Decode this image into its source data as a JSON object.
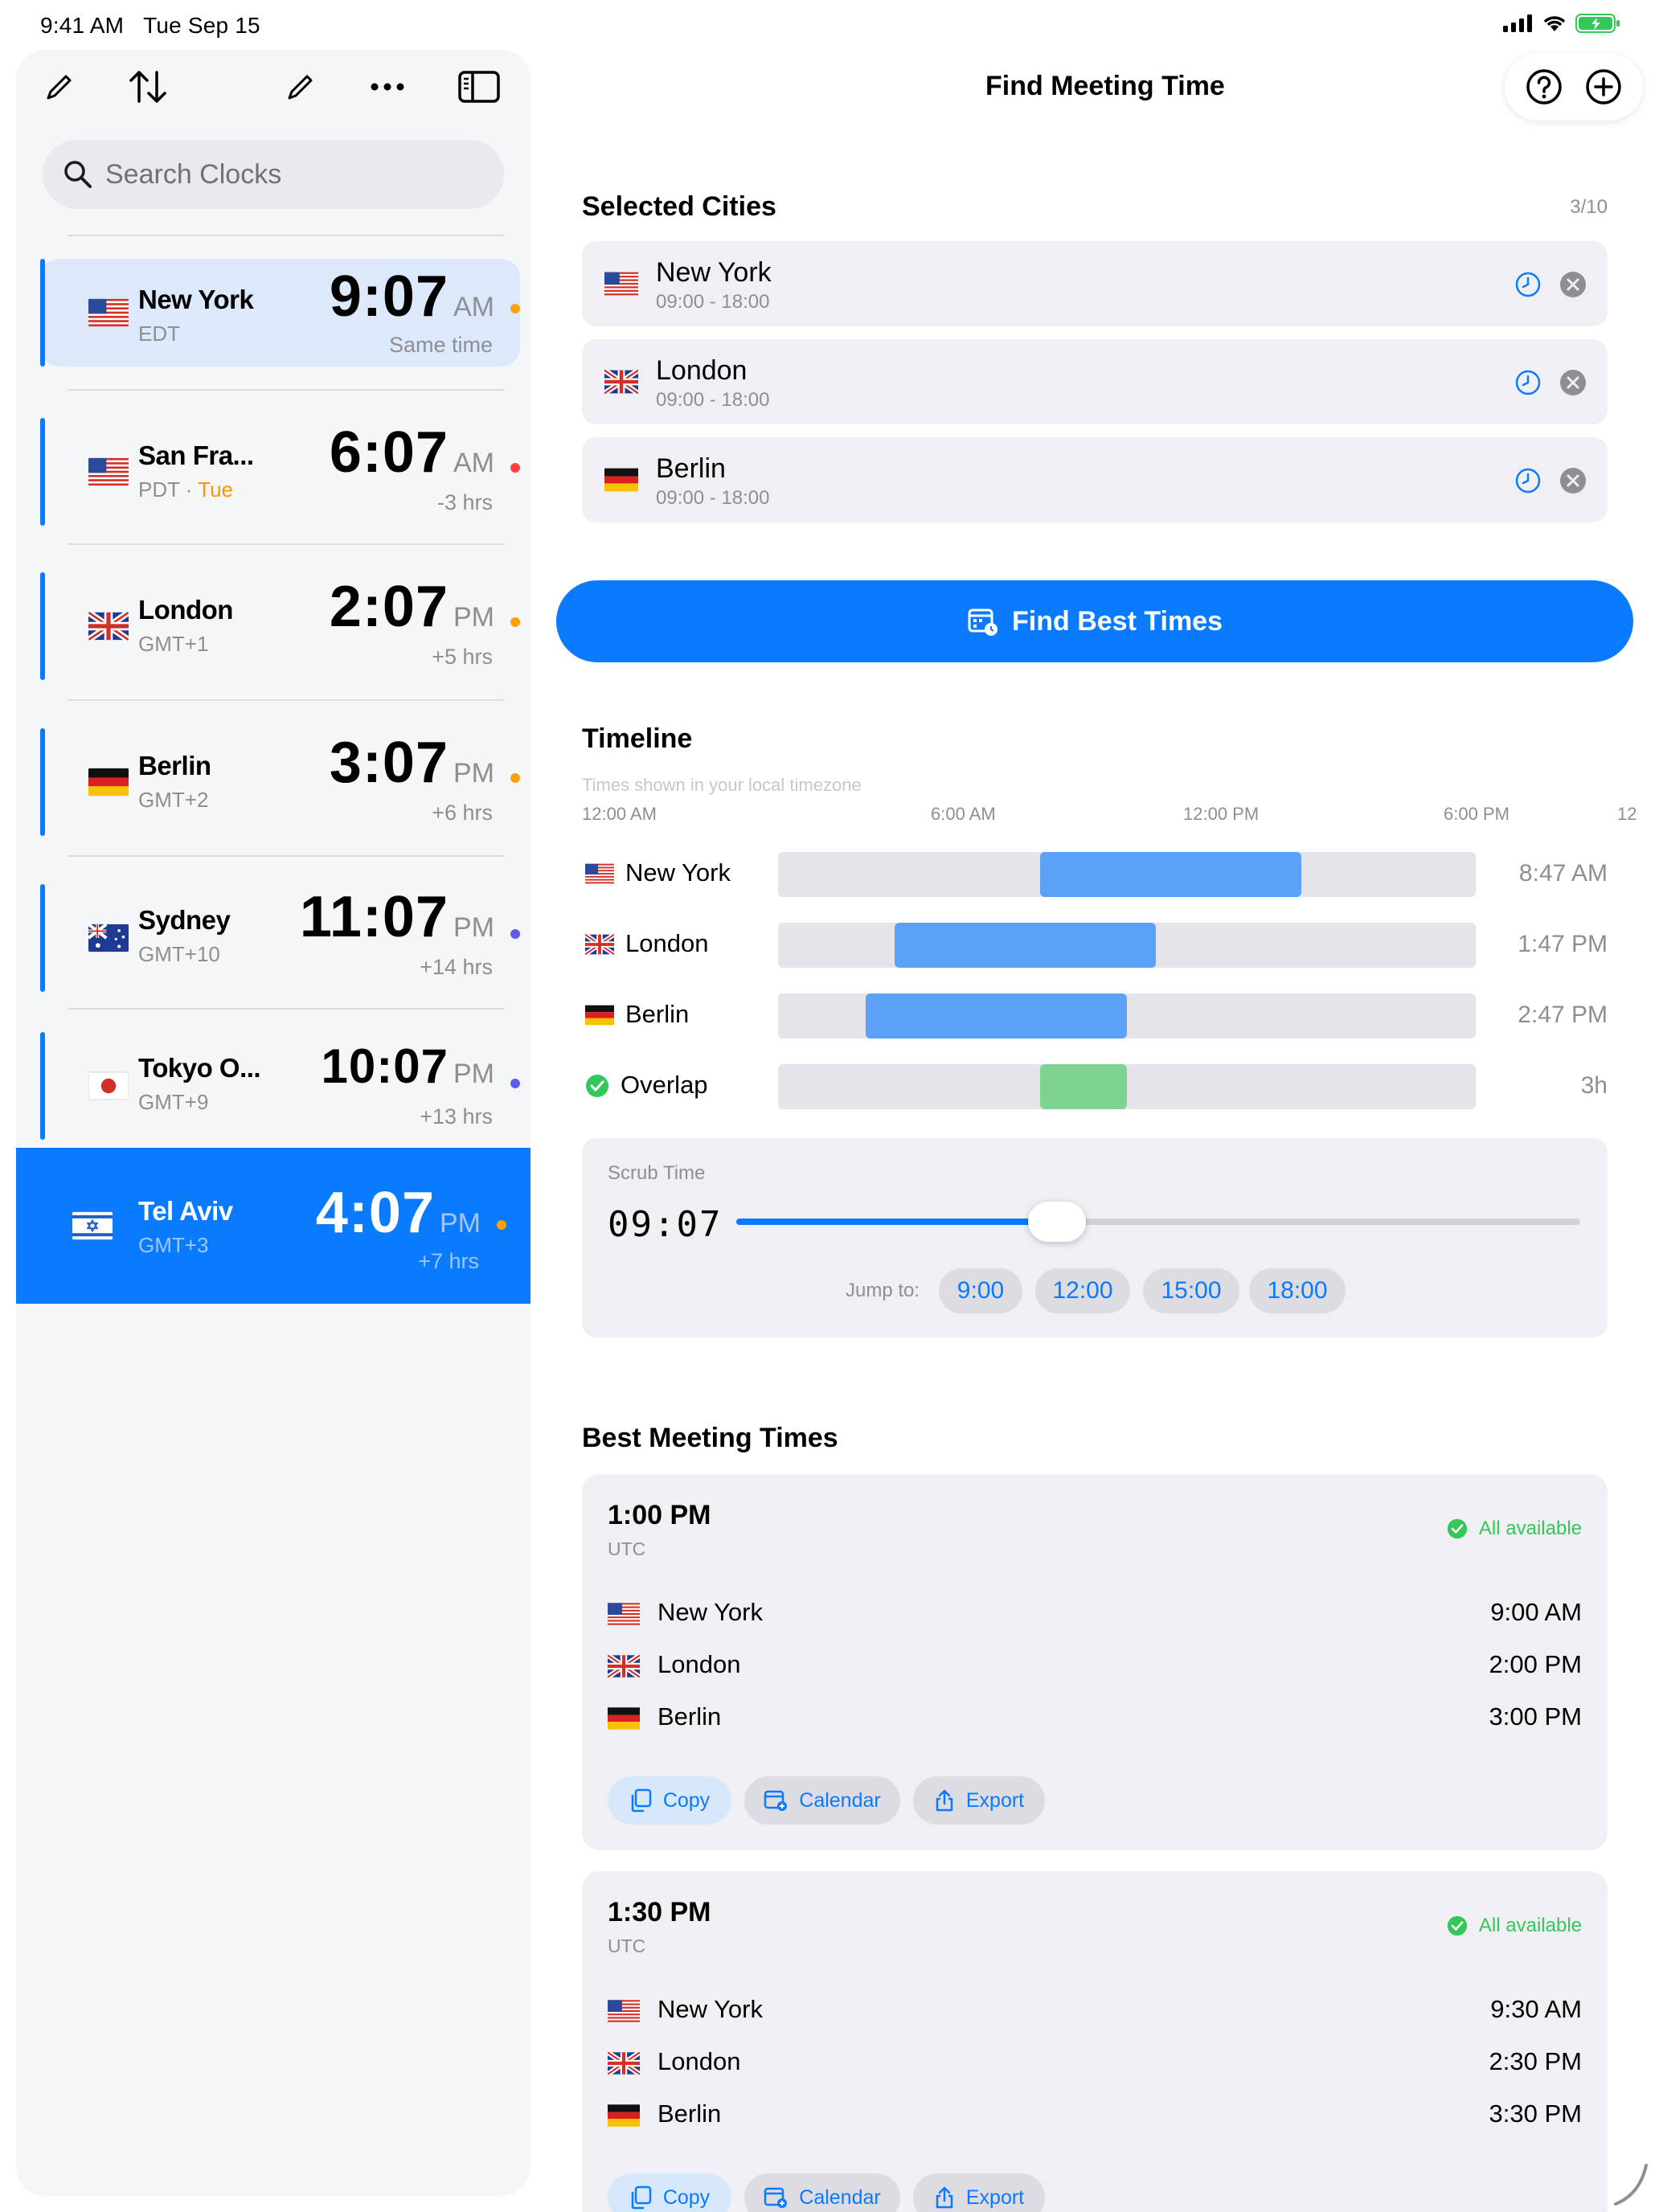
{
  "status": {
    "time": "9:41 AM",
    "date": "Tue Sep 15"
  },
  "sidebar": {
    "search_placeholder": "Search Clocks",
    "clocks": [
      {
        "city": "New York",
        "tz": "EDT",
        "tz_extra": "",
        "time": "9:07",
        "ampm": "AM",
        "diff": "Same time",
        "dot_color": "#ff9f0a"
      },
      {
        "city": "San Fra...",
        "tz": "PDT",
        "tz_extra": "Tue",
        "time": "6:07",
        "ampm": "AM",
        "diff": "-3 hrs",
        "dot_color": "#ff453a"
      },
      {
        "city": "London",
        "tz": "GMT+1",
        "tz_extra": "",
        "time": "2:07",
        "ampm": "PM",
        "diff": "+5 hrs",
        "dot_color": "#ff9f0a"
      },
      {
        "city": "Berlin",
        "tz": "GMT+2",
        "tz_extra": "",
        "time": "3:07",
        "ampm": "PM",
        "diff": "+6 hrs",
        "dot_color": "#ff9f0a"
      },
      {
        "city": "Sydney",
        "tz": "GMT+10",
        "tz_extra": "",
        "time": "11:07",
        "ampm": "PM",
        "diff": "+14 hrs",
        "dot_color": "#5e5ce6"
      },
      {
        "city": "Tokyo O...",
        "tz": "GMT+9",
        "tz_extra": "",
        "time": "10:07",
        "ampm": "PM",
        "diff": "+13 hrs",
        "dot_color": "#5e5ce6"
      },
      {
        "city": "Tel Aviv",
        "tz": "GMT+3",
        "tz_extra": "",
        "time": "4:07",
        "ampm": "PM",
        "diff": "+7 hrs",
        "dot_color": "#ff9f0a"
      }
    ]
  },
  "main": {
    "title": "Find Meeting Time",
    "selected_heading": "Selected Cities",
    "selected_count": "3/10",
    "selected_cities": [
      {
        "name": "New York",
        "hours": "09:00 - 18:00"
      },
      {
        "name": "London",
        "hours": "09:00 - 18:00"
      },
      {
        "name": "Berlin",
        "hours": "09:00 - 18:00"
      }
    ],
    "find_button": "Find Best Times",
    "timeline": {
      "heading": "Timeline",
      "note": "Times shown in your local timezone",
      "axis": [
        "12:00 AM",
        "6:00 AM",
        "12:00 PM",
        "6:00 PM",
        "12"
      ],
      "rows": [
        {
          "label": "New York",
          "value": "8:47 AM",
          "start": 0.375,
          "end": 0.75,
          "color": "#5aa1f7"
        },
        {
          "label": "London",
          "value": "1:47 PM",
          "start": 0.167,
          "end": 0.542,
          "color": "#5aa1f7"
        },
        {
          "label": "Berlin",
          "value": "2:47 PM",
          "start": 0.125,
          "end": 0.5,
          "color": "#5aa1f7"
        },
        {
          "label": "Overlap",
          "value": "3h",
          "start": 0.375,
          "end": 0.5,
          "color": "#7dd491"
        }
      ]
    },
    "scrub": {
      "label": "Scrub Time",
      "value": "09:07",
      "fraction": 0.38,
      "jump_label": "Jump to:",
      "jumps": [
        "9:00",
        "12:00",
        "15:00",
        "18:00"
      ]
    },
    "best_heading": "Best Meeting Times",
    "meetings": [
      {
        "time": "1:00 PM",
        "tz": "UTC",
        "status": "All available",
        "rows": [
          {
            "city": "New York",
            "time": "9:00 AM"
          },
          {
            "city": "London",
            "time": "2:00 PM"
          },
          {
            "city": "Berlin",
            "time": "3:00 PM"
          }
        ],
        "actions": {
          "copy": "Copy",
          "calendar": "Calendar",
          "export": "Export"
        }
      },
      {
        "time": "1:30 PM",
        "tz": "UTC",
        "status": "All available",
        "rows": [
          {
            "city": "New York",
            "time": "9:30 AM"
          },
          {
            "city": "London",
            "time": "2:30 PM"
          },
          {
            "city": "Berlin",
            "time": "3:30 PM"
          }
        ],
        "actions": {
          "copy": "Copy",
          "calendar": "Calendar",
          "export": "Export"
        }
      }
    ]
  }
}
